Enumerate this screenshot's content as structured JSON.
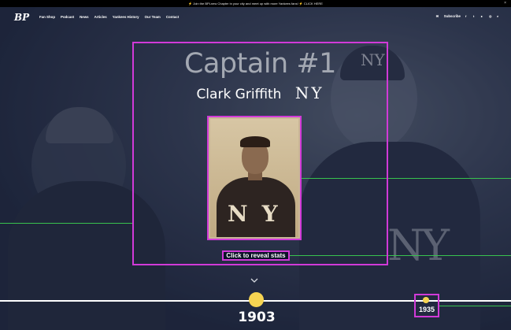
{
  "announcement": {
    "text": "⚡ Join the BPLnew Chapter in your city and meet up with more Yankees fans! ⚡ CLICK HERE",
    "close": "×"
  },
  "nav": {
    "logo": "BP",
    "items": [
      "Fan Shop",
      "Podcast",
      "News",
      "Articles",
      "Yankees History",
      "Our Team",
      "Contact"
    ],
    "subscribe": "Subscribe",
    "social_icons": [
      "facebook-icon",
      "twitter-icon",
      "youtube-icon",
      "instagram-icon",
      "search-icon"
    ]
  },
  "card": {
    "title": "Captain #1",
    "player_name": "Clark Griffith",
    "team": "NY",
    "photo_jersey": "NY",
    "reveal_button": "Click to reveal stats"
  },
  "timeline": {
    "current_year": "1903",
    "next_year": "1935",
    "accent_color": "#f6d452"
  },
  "highlight_color": "#d13ad8"
}
